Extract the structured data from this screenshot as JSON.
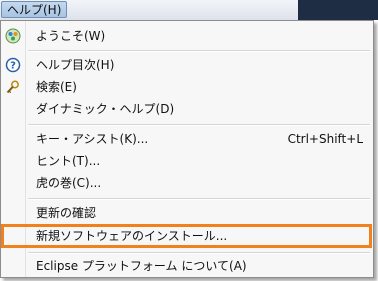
{
  "menubar": {
    "help_label": "ヘルプ(H)"
  },
  "menu": {
    "welcome": "ようこそ(W)",
    "help_contents": "ヘルプ目次(H)",
    "search": "検索(E)",
    "dynamic_help": "ダイナミック・ヘルプ(D)",
    "key_assist": "キー・アシスト(K)...",
    "key_assist_shortcut": "Ctrl+Shift+L",
    "tips": "ヒント(T)...",
    "tricks": "虎の巻(C)...",
    "check_updates": "更新の確認",
    "install_new_software": "新規ソフトウェアのインストール...",
    "about_eclipse": "Eclipse プラットフォーム について(A)"
  },
  "colors": {
    "highlight_border": "#f0811c",
    "menubar_active": "#a7c4e2"
  },
  "icons": {
    "welcome": "eclipse-welcome-icon",
    "help_contents": "help-question-icon",
    "search": "search-key-icon"
  }
}
